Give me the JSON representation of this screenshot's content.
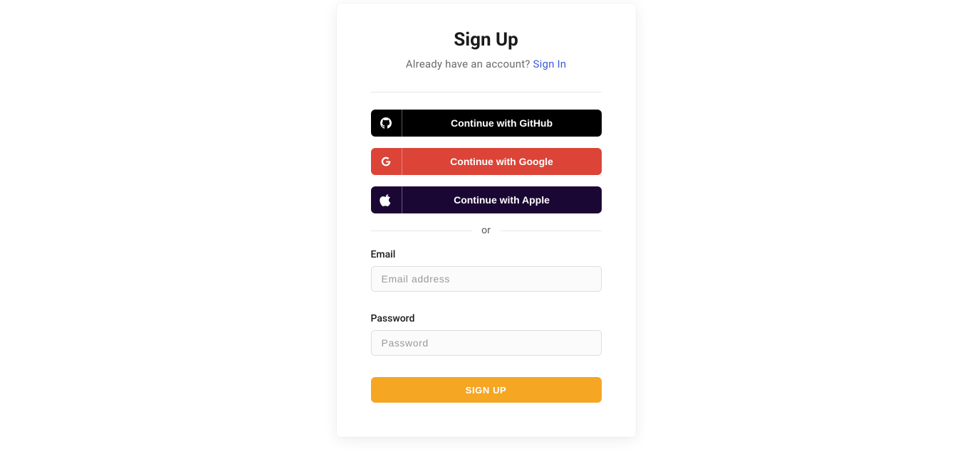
{
  "title": "Sign Up",
  "subtitle": {
    "text": "Already have an account? ",
    "link_text": "Sign In"
  },
  "social": {
    "github": "Continue with GitHub",
    "google": "Continue with Google",
    "apple": "Continue with Apple"
  },
  "divider_text": "or",
  "form": {
    "email_label": "Email",
    "email_placeholder": "Email address",
    "password_label": "Password",
    "password_placeholder": "Password",
    "submit_label": "SIGN UP"
  }
}
